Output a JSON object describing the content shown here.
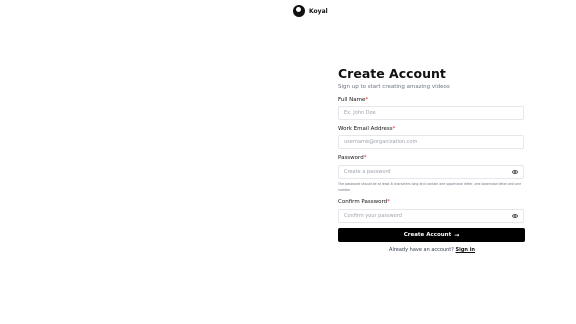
{
  "brand": {
    "name": "Koyal"
  },
  "form": {
    "title": "Create Account",
    "subtitle": "Sign up to start creating amazing videos",
    "full_name": {
      "label": "Full Name",
      "required": "*",
      "placeholder": "Ex. John Doe",
      "value": ""
    },
    "email": {
      "label": "Work Email Address",
      "required": "*",
      "placeholder": "username@organization.com",
      "value": ""
    },
    "password": {
      "label": "Password",
      "required": "*",
      "placeholder": "Create a password",
      "value": ""
    },
    "password_hint": "The password should be at least 8 characters long and contain one uppercase letter, one lowercase letter and one number",
    "confirm_password": {
      "label": "Confirm Password",
      "required": "*",
      "placeholder": "Confirm your password",
      "value": ""
    },
    "submit_label": "Create Account",
    "submit_icon": "arrow-right-icon",
    "signin_prompt": "Already have an account?",
    "signin_link": "Sign in"
  },
  "colors": {
    "accent": "#000000",
    "required": "#dc2626",
    "muted": "#6b7280",
    "border": "#e5e7eb"
  }
}
